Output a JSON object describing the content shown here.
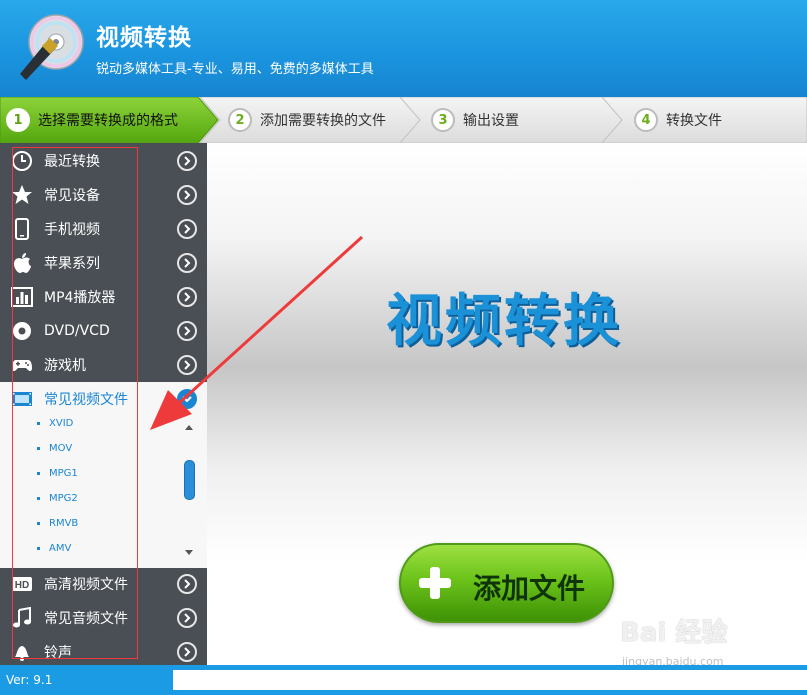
{
  "app": {
    "title": "视频转换",
    "subtitle": "锐动多媒体工具-专业、易用、免费的多媒体工具"
  },
  "steps": [
    {
      "num": "1",
      "label": "选择需要转换成的格式",
      "active": true
    },
    {
      "num": "2",
      "label": "添加需要转换的文件",
      "active": false
    },
    {
      "num": "3",
      "label": "输出设置",
      "active": false
    },
    {
      "num": "4",
      "label": "转换文件",
      "active": false
    }
  ],
  "sidebar": {
    "items": [
      {
        "label": "最近转换",
        "icon": "clock-icon"
      },
      {
        "label": "常见设备",
        "icon": "star-icon"
      },
      {
        "label": "手机视频",
        "icon": "phone-icon"
      },
      {
        "label": "苹果系列",
        "icon": "apple-icon"
      },
      {
        "label": "MP4播放器",
        "icon": "bar-chart-icon"
      },
      {
        "label": "DVD/VCD",
        "icon": "disc-icon"
      },
      {
        "label": "游戏机",
        "icon": "gamepad-icon"
      },
      {
        "label": "常见视频文件",
        "icon": "film-icon",
        "expanded": true
      },
      {
        "label": "高清视频文件",
        "icon": "hd-icon"
      },
      {
        "label": "常见音频文件",
        "icon": "music-note-icon"
      },
      {
        "label": "铃声",
        "icon": "bell-icon"
      }
    ],
    "sub_items": [
      "XVID",
      "MOV",
      "MPG1",
      "MPG2",
      "RMVB",
      "AMV"
    ]
  },
  "main": {
    "title": "视频转换",
    "add_button_label": "添加文件"
  },
  "status": {
    "version": "Ver: 9.1"
  },
  "watermark": {
    "text": "Bai 经验",
    "sub": "jingyan.baidu.com"
  },
  "colors": {
    "header_blue": "#1b95df",
    "sidebar_bg": "#4a4f55",
    "accent_blue": "#1a86d2",
    "step_active_green": "#6cc31a",
    "button_green": "#6cc31a",
    "annotation_red": "#ee3a3a"
  }
}
